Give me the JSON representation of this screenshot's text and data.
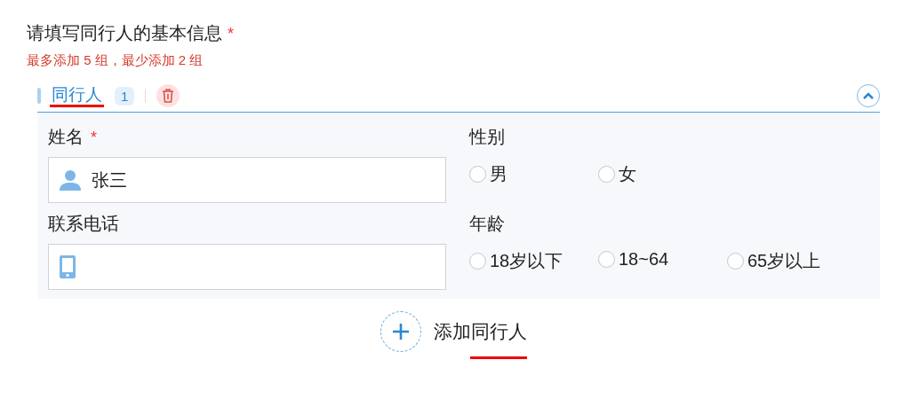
{
  "section": {
    "title": "请填写同行人的基本信息",
    "required_mark": "*",
    "hint": "最多添加 5 组，最少添加 2 组"
  },
  "companion": {
    "label": "同行人",
    "index": "1",
    "expanded": true
  },
  "fields": [
    {
      "kind": "name",
      "label": "姓名",
      "required_mark": "*",
      "value": "张三"
    },
    {
      "kind": "radio",
      "label": "性别",
      "options": [
        {
          "label": "男",
          "selected": false
        },
        {
          "label": "女",
          "selected": false
        }
      ]
    },
    {
      "kind": "phone",
      "label": "联系电话"
    },
    {
      "kind": "radio",
      "label": "年龄",
      "options": [
        {
          "label": "18岁以下",
          "selected": false
        },
        {
          "label": "18~64",
          "selected": false
        },
        {
          "label": "65岁以上",
          "selected": false
        }
      ]
    }
  ],
  "add_button": {
    "label": "添加同行人"
  }
}
